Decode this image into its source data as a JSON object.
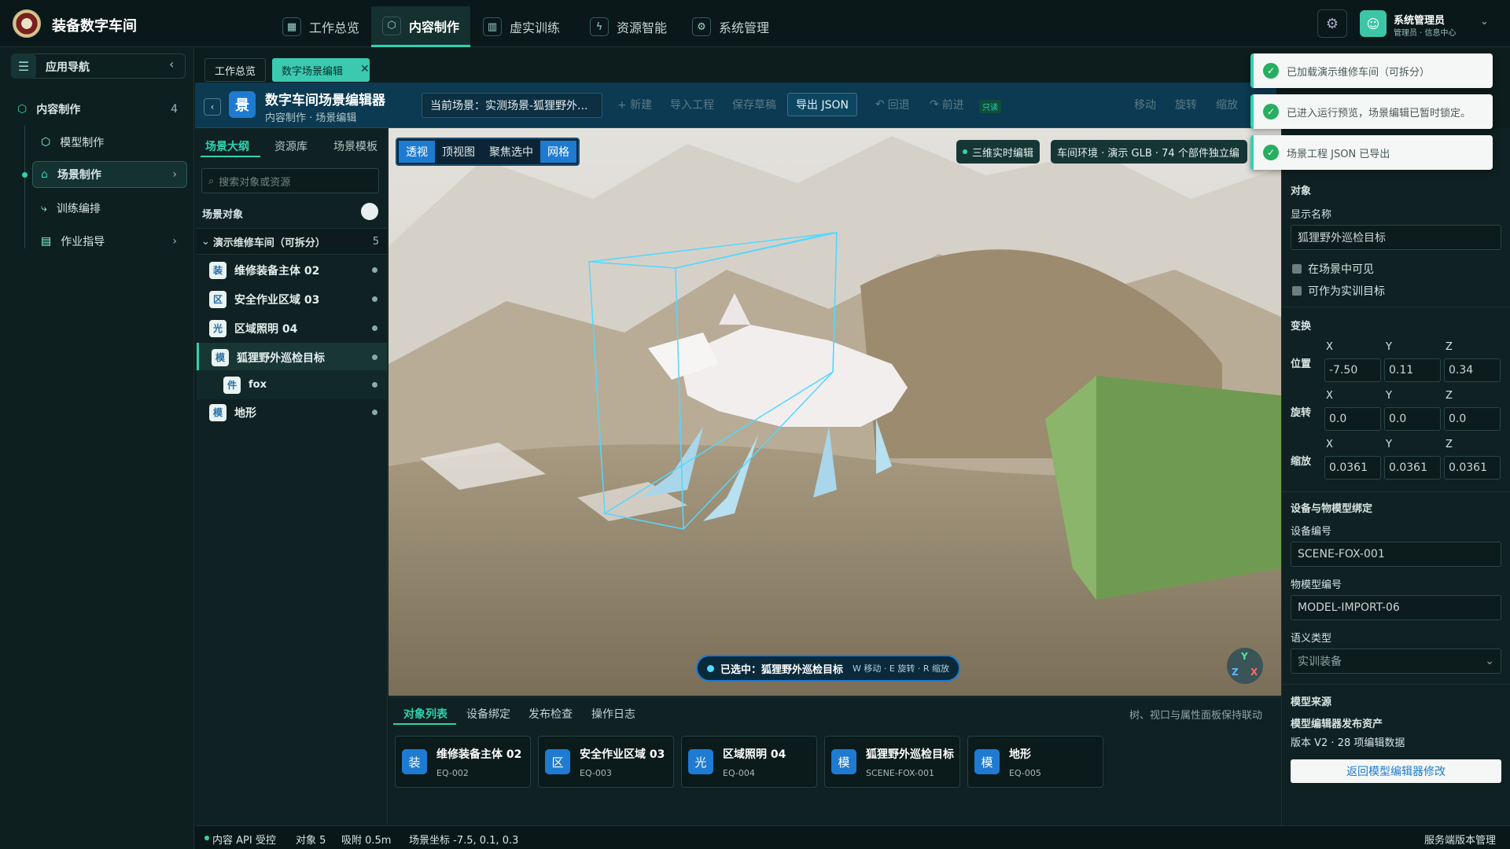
{
  "app": {
    "title": "装备数字车间"
  },
  "topnav": [
    {
      "label": "工作总览",
      "icon": "grid-icon"
    },
    {
      "label": "内容制作",
      "icon": "cube-icon"
    },
    {
      "label": "虚实训练",
      "icon": "book-icon"
    },
    {
      "label": "资源智能",
      "icon": "bolt-icon"
    },
    {
      "label": "系统管理",
      "icon": "gear-icon"
    }
  ],
  "user": {
    "name": "系统管理员",
    "role": "管理员 · 信息中心"
  },
  "leftnav": {
    "title": "应用导航",
    "section": "内容制作",
    "section_count": "4",
    "items": [
      {
        "label": "模型制作"
      },
      {
        "label": "场景制作"
      },
      {
        "label": "训练编排"
      },
      {
        "label": "作业指导"
      }
    ]
  },
  "tabs": [
    {
      "label": "工作总览"
    },
    {
      "label": "数字场景编辑"
    }
  ],
  "toolbar": {
    "title": "数字车间场景编辑器",
    "subtitle": "内容制作 · 场景编辑",
    "badge": "景",
    "current_scene": "当前场景：实测场景-狐狸野外...",
    "new": "+ 新建",
    "import": "导入工程",
    "save": "保存草稿",
    "export": "导出 JSON",
    "undo": "回退",
    "redo": "前进",
    "readonly": "只读",
    "move": "移动",
    "rotate": "旋转",
    "scale": "缩放"
  },
  "tree": {
    "tabs": [
      "场景大纲",
      "资源库",
      "场景模板"
    ],
    "search_placeholder": "搜索对象或资源",
    "heading": "场景对象",
    "group": "演示维修车间（可拆分）",
    "group_count": "5",
    "rows": [
      {
        "badge": "装",
        "label": "维修装备主体 02"
      },
      {
        "badge": "区",
        "label": "安全作业区域 03"
      },
      {
        "badge": "光",
        "label": "区域照明 04"
      },
      {
        "badge": "模",
        "label": "狐狸野外巡检目标"
      },
      {
        "badge": "件",
        "label": "fox"
      },
      {
        "badge": "模",
        "label": "地形"
      }
    ]
  },
  "viewport": {
    "view_buttons": [
      "透视",
      "顶视图",
      "聚焦选中",
      "网格"
    ],
    "realtime": "三维实时编辑",
    "env": "车间环境 · 演示 GLB · 74 个部件独立编",
    "selected_prefix": "已选中：狐狸野外巡检目标",
    "shortcut": "W 移动 · E 旋转 · R 缩放",
    "axis": {
      "y": "Y",
      "z": "Z",
      "x": "X"
    }
  },
  "bottom": {
    "tabs": [
      "对象列表",
      "设备绑定",
      "发布检查",
      "操作日志"
    ],
    "hint": "树、视口与属性面板保持联动",
    "cards": [
      {
        "icon": "装",
        "name": "维修装备主体 02",
        "code": "EQ-002"
      },
      {
        "icon": "区",
        "name": "安全作业区域 03",
        "code": "EQ-003"
      },
      {
        "icon": "光",
        "name": "区域照明 04",
        "code": "EQ-004"
      },
      {
        "icon": "模",
        "name": "狐狸野外巡检目标",
        "code": "SCENE-FOX-001"
      },
      {
        "icon": "模",
        "name": "地形",
        "code": "EQ-005"
      }
    ]
  },
  "status": {
    "api": "内容 API 受控",
    "objects": "对象 5",
    "snap": "吸附 0.5m",
    "coord": "场景坐标 -7.5, 0.1, 0.3",
    "right": "服务端版本管理"
  },
  "props": {
    "object_heading": "对象",
    "display_name_label": "显示名称",
    "display_name": "狐狸野外巡检目标",
    "visible": "在场景中可见",
    "target": "可作为实训目标",
    "transform": "变换",
    "axes": [
      "X",
      "Y",
      "Z"
    ],
    "position_label": "位置",
    "position": [
      "-7.50",
      "0.11",
      "0.34"
    ],
    "rotation_label": "旋转",
    "rotation": [
      "0.0",
      "0.0",
      "0.0"
    ],
    "scale_label": "缩放",
    "scale": [
      "0.0361",
      "0.0361",
      "0.0361"
    ],
    "binding_heading": "设备与物模型绑定",
    "device_label": "设备编号",
    "device": "SCENE-FOX-001",
    "model_label": "物模型编号",
    "model": "MODEL-IMPORT-06",
    "semantic_label": "语义类型",
    "semantic": "实训装备",
    "source_heading": "模型来源",
    "source_title": "模型编辑器发布资产",
    "source_version": "版本 V2 · 28 项编辑数据",
    "back_btn": "返回模型编辑器修改"
  },
  "toasts": [
    "已加载演示维修车间（可拆分）",
    "已进入运行预览，场景编辑已暂时锁定。",
    "场景工程 JSON 已导出"
  ],
  "colors": {
    "accent": "#2fd2b0",
    "primary_blue": "#1e7bd1",
    "selection_box": "#54d8ff"
  }
}
